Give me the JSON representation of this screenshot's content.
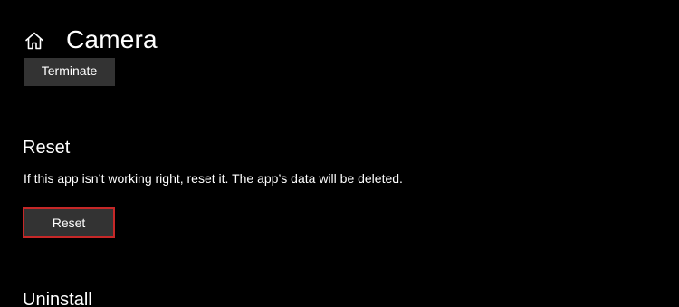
{
  "header": {
    "icon": "home-icon",
    "title": "Camera"
  },
  "terminate": {
    "button_label": "Terminate"
  },
  "reset": {
    "heading": "Reset",
    "description": "If this app isn’t working right, reset it. The app’s data will be deleted.",
    "button_label": "Reset",
    "button_border_color": "#c62828"
  },
  "uninstall": {
    "heading": "Uninstall"
  },
  "colors": {
    "background": "#000000",
    "button_background": "#333333",
    "text": "#ffffff"
  }
}
